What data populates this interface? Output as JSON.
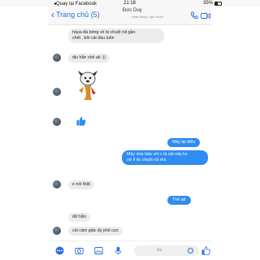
{
  "status_bar": {
    "back_to_app": "◂Quay lại Facebook",
    "time": "21:18",
    "battery": "35%"
  },
  "header": {
    "back_label": "Trang chủ (5)",
    "contact_name": "Đức Duy",
    "subtitle": "Hoạt động 1 giờ trước",
    "icons": [
      "chevron-left-icon",
      "phone-icon",
      "video-camera-icon"
    ],
    "accent": "#2a6fdb"
  },
  "messages": {
    "m1_line1": "hqua đá bóng về bị chuột rút gần",
    "m1_line2": "chết , bôi cái dầu luôn",
    "m2": "dịu hẳn chế ak :))",
    "m3": "Mày lại điêu",
    "m4_line1": "Mày vừa bảo với c là cái này ko",
    "m4_line2": "xử lí dc chuột rút ma",
    "m5": "e nói thật",
    "m6": "Thế ạd",
    "m7": "dữ hẳn",
    "m8": "cái cảm giác ấy phê cực"
  },
  "colors": {
    "outgoing_bubble": "#2f8cf0",
    "incoming_bubble": "#ececec"
  },
  "composer": {
    "placeholder": "Aa",
    "icons": [
      "more-icon",
      "camera-icon",
      "image-icon",
      "microphone-icon",
      "emoji-icon",
      "like-icon"
    ]
  }
}
